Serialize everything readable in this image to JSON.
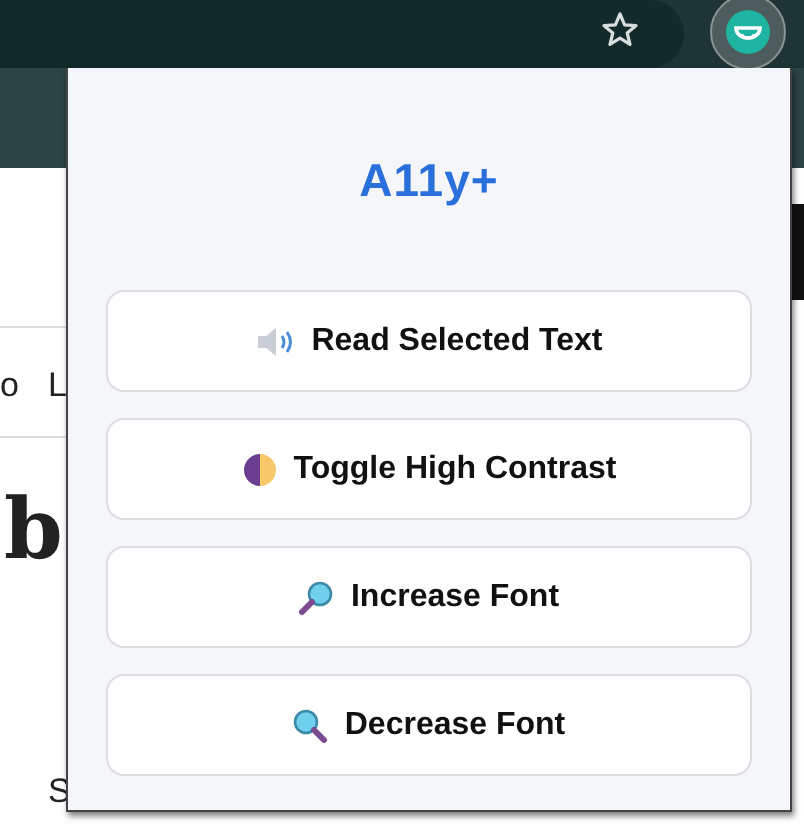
{
  "page_behind": {
    "fragments": [
      {
        "text": "o",
        "kind": "nav"
      },
      {
        "text": "L",
        "kind": "nav"
      },
      {
        "text": "b",
        "kind": "heading"
      },
      {
        "text": "S",
        "kind": "body"
      }
    ]
  },
  "popup": {
    "title": "A11y+",
    "buttons": [
      {
        "label": "Read Selected Text",
        "kind": "speaker"
      },
      {
        "label": "Toggle High Contrast",
        "kind": "contrast"
      },
      {
        "label": "Increase Font",
        "kind": "zoom-in"
      },
      {
        "label": "Decrease Font",
        "kind": "zoom-out"
      }
    ]
  }
}
